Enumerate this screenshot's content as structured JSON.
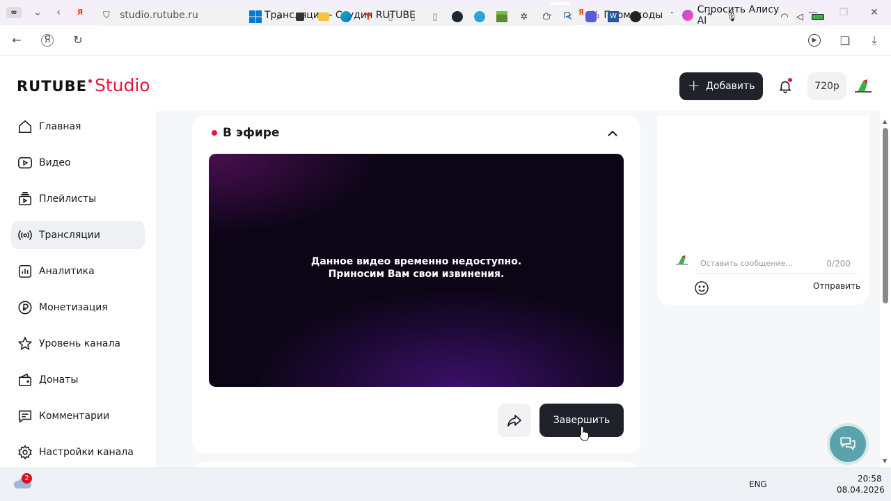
{
  "browser": {
    "url": "studio.rutube.ru",
    "page_title": "Трансляции - Студия RUTUBE",
    "promo_label": "Промокоды",
    "alice_label": "Спросить Алису AI",
    "tab_glyphs": {
      "yandex": "Я",
      "github": "◎",
      "doc": "▢",
      "play": "▶",
      "rutube": "R",
      "steam": "◉"
    }
  },
  "header": {
    "logo_main": "RUTUBE",
    "logo_studio": "Studio",
    "add_label": "Добавить",
    "quality": "720p"
  },
  "sidebar": {
    "items": [
      {
        "label": "Главная",
        "icon": "home-icon"
      },
      {
        "label": "Видео",
        "icon": "video-icon"
      },
      {
        "label": "Плейлисты",
        "icon": "playlist-icon"
      },
      {
        "label": "Трансляции",
        "icon": "broadcast-icon"
      },
      {
        "label": "Аналитика",
        "icon": "analytics-icon"
      },
      {
        "label": "Монетизация",
        "icon": "ruble-icon"
      },
      {
        "label": "Уровень канала",
        "icon": "star-icon"
      },
      {
        "label": "Донаты",
        "icon": "wallet-icon"
      },
      {
        "label": "Комментарии",
        "icon": "comment-icon"
      },
      {
        "label": "Настройки канала",
        "icon": "gear-icon"
      }
    ],
    "active_index": 3
  },
  "stream": {
    "status_label": "В эфире",
    "unavailable_line1": "Данное видео временно недоступно.",
    "unavailable_line2": "Приносим Вам свои извинения.",
    "finish_label": "Завершить"
  },
  "chat": {
    "placeholder": "Оставить сообщение...",
    "counter": "0/200",
    "send_label": "Отправить"
  },
  "taskbar": {
    "weather_badge": "2",
    "language": "ENG",
    "time": "20:58",
    "date": "08.04.2026"
  },
  "colors": {
    "brand": "#ed143b",
    "dark_button": "#1f2229",
    "support": "#5aa3ac"
  }
}
